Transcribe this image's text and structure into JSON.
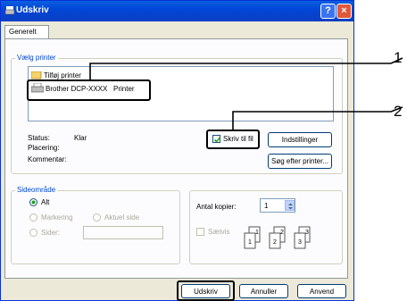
{
  "window": {
    "title": "Udskriv",
    "help_glyph": "?",
    "close_glyph": "×"
  },
  "tabs": [
    {
      "label": "Generelt"
    }
  ],
  "printer_group": {
    "legend": "Vælg printer",
    "items": [
      {
        "label": "Tilføj printer",
        "icon": "add-printer-icon"
      },
      {
        "label": "Brother DCP-XXXX   Printer",
        "icon": "printer-icon",
        "selected": true
      }
    ],
    "status_label": "Status:",
    "status_value": "Klar",
    "location_label": "Placering:",
    "comment_label": "Kommentar:",
    "print_to_file": {
      "label": "Skriv til fil",
      "checked": true
    },
    "settings_button": "Indstillinger",
    "find_printer_button": "Søg efter printer..."
  },
  "page_range": {
    "legend": "Sideområde",
    "all": {
      "label": "Alt",
      "selected": true
    },
    "selection": {
      "label": "Markering",
      "enabled": false
    },
    "current_page": {
      "label": "Aktuel side",
      "enabled": false
    },
    "pages": {
      "label": "Sider:",
      "enabled": false,
      "value": ""
    }
  },
  "copies": {
    "label": "Antal kopier:",
    "value": "1",
    "collate": {
      "label": "Sætvis",
      "checked": false,
      "enabled": false
    },
    "collate_pages": [
      "1",
      "1",
      "2",
      "2",
      "3",
      "3"
    ]
  },
  "footer": {
    "print": "Udskriv",
    "apply": "Annuller",
    "cancel": "Anvend"
  },
  "callouts": [
    "1",
    "2"
  ],
  "colors": {
    "title_bar": "#0a5fe0",
    "face": "#ece9d8",
    "highlight_border": "#000000"
  }
}
